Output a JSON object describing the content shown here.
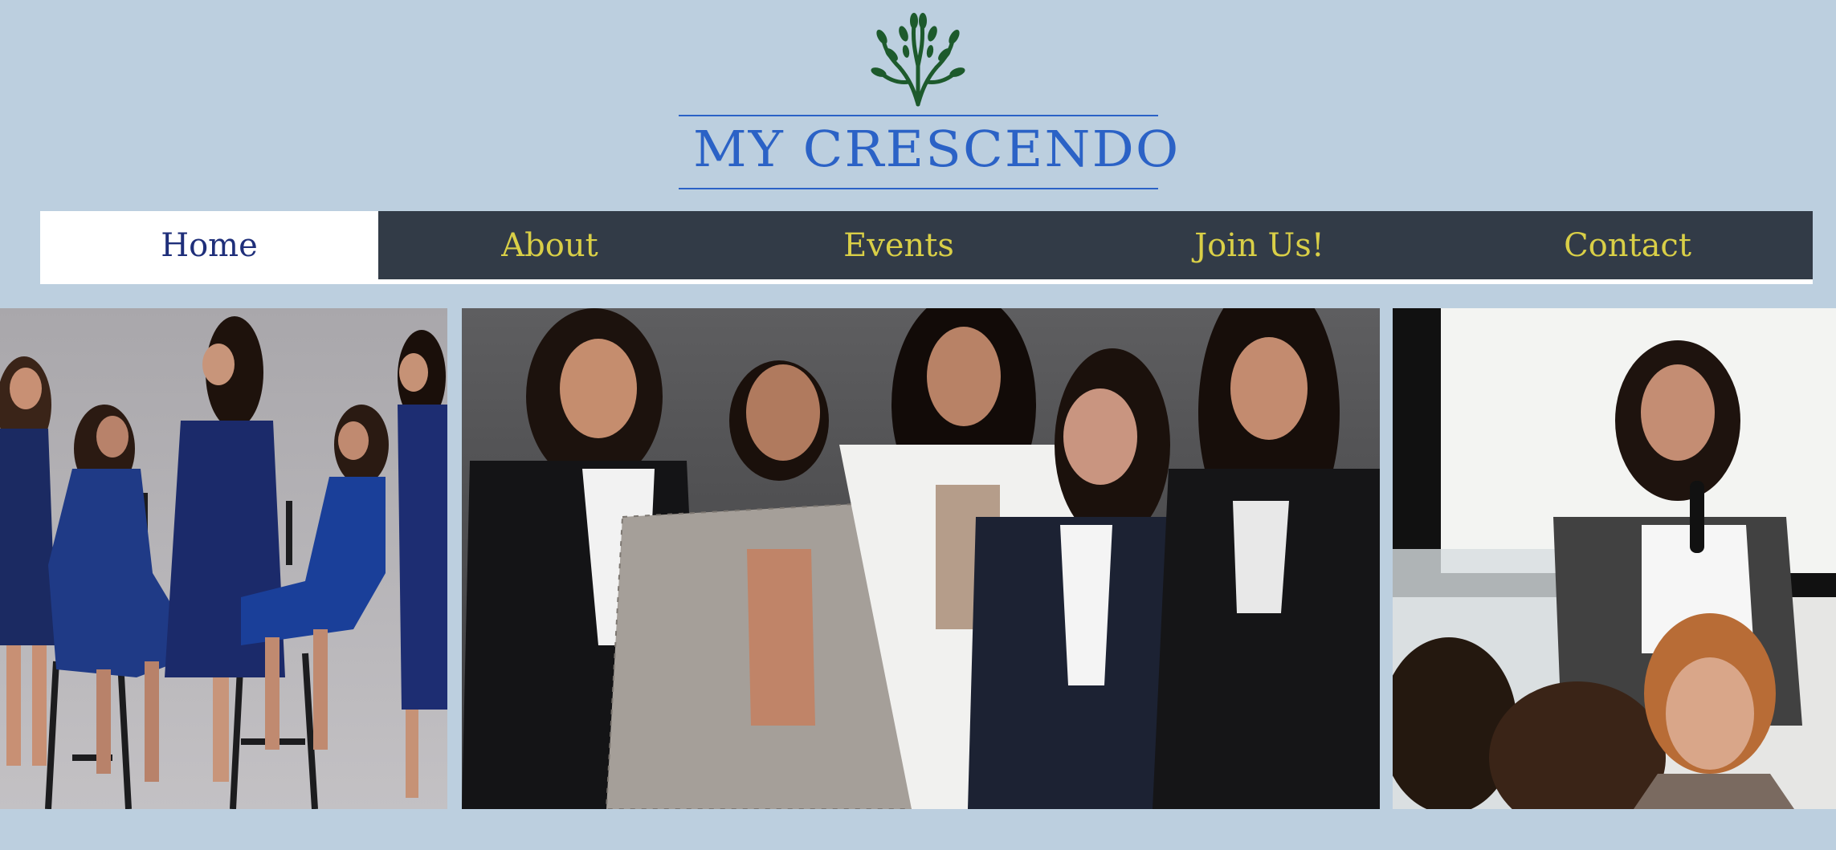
{
  "brand": {
    "logo_icon": "tree-icon",
    "title": "MY CRESCENDO",
    "accent_color": "#2b62c6",
    "logo_color": "#1d5a2c"
  },
  "nav": {
    "background": "#323b47",
    "text_color": "#d9cf47",
    "active_text_color": "#1f2f7a",
    "items": [
      {
        "label": "Home",
        "active": true
      },
      {
        "label": "About",
        "active": false
      },
      {
        "label": "Events",
        "active": false
      },
      {
        "label": "Join Us!",
        "active": false
      },
      {
        "label": "Contact",
        "active": false
      }
    ]
  },
  "gallery": {
    "photos": [
      {
        "name": "group-seated-photo",
        "subject": "five women in navy dresses, some seated on bar stools"
      },
      {
        "name": "group-portrait-photo",
        "subject": "five women in business blazers posing together"
      },
      {
        "name": "speaker-photo",
        "subject": "woman speaking into a microphone beside a podium, audience in foreground"
      }
    ]
  }
}
